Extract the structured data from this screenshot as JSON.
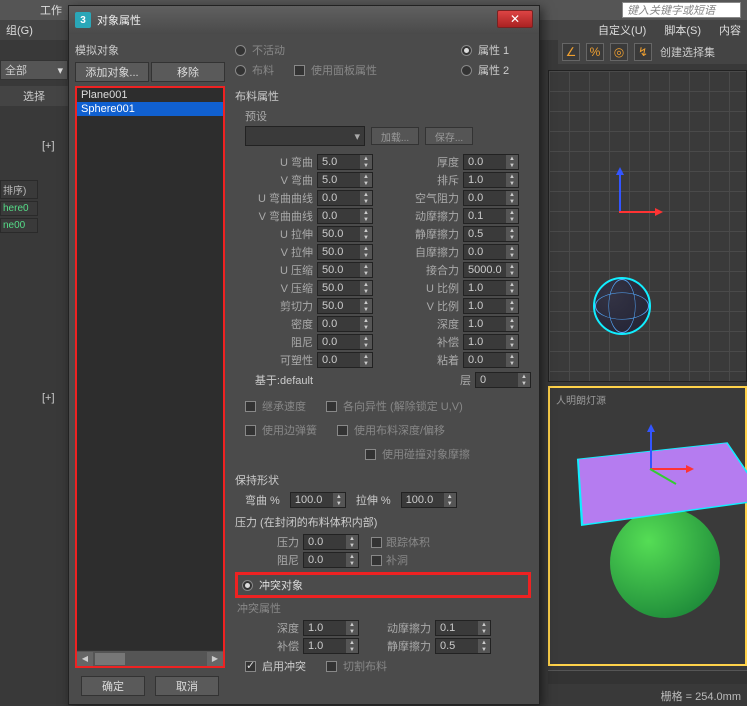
{
  "bg": {
    "topTabs": [
      "工作"
    ],
    "search_placeholder": "键入关键字或短语",
    "menubar": [
      "组(G)"
    ],
    "menubarRight": [
      "自定义(U)",
      "脚本(S)",
      "内容"
    ],
    "iconRowLabel": "创建选择集",
    "dropdown": "全部",
    "select": "选择",
    "leftTabs": [
      "排序)",
      "here0",
      "ne00"
    ],
    "marker1": "[+]",
    "marker2": "[+]",
    "vpLabel": "人明朗灯源",
    "status": "栅格 = 254.0mm"
  },
  "dialog": {
    "title": "对象属性",
    "icon": "3",
    "left": {
      "section": "模拟对象",
      "addBtn": "添加对象...",
      "removeBtn": "移除",
      "items": [
        "Plane001",
        "Sphere001"
      ],
      "ok": "确定",
      "cancel": "取消"
    },
    "right": {
      "radios": {
        "inactive": "不活动",
        "cloth": "布料",
        "useFaceCloth": "使用面板属性",
        "prop1": "属性 1",
        "prop2": "属性 2"
      },
      "clothProps": "布料属性",
      "preset": "预设",
      "loadBtn": "加载...",
      "saveBtn": "保存...",
      "paramsLeft": [
        {
          "l": "U 弯曲",
          "v": "5.0"
        },
        {
          "l": "V 弯曲",
          "v": "5.0"
        },
        {
          "l": "U 弯曲曲线",
          "v": "0.0"
        },
        {
          "l": "V 弯曲曲线",
          "v": "0.0"
        },
        {
          "l": "U 拉伸",
          "v": "50.0"
        },
        {
          "l": "V 拉伸",
          "v": "50.0"
        },
        {
          "l": "U 压缩",
          "v": "50.0"
        },
        {
          "l": "V 压缩",
          "v": "50.0"
        },
        {
          "l": "剪切力",
          "v": "50.0"
        },
        {
          "l": "密度",
          "v": "0.0"
        },
        {
          "l": "阻尼",
          "v": "0.0"
        },
        {
          "l": "可塑性",
          "v": "0.0"
        }
      ],
      "paramsRight": [
        {
          "l": "厚度",
          "v": "0.0"
        },
        {
          "l": "排斥",
          "v": "1.0"
        },
        {
          "l": "空气阻力",
          "v": "0.0"
        },
        {
          "l": "动摩擦力",
          "v": "0.1"
        },
        {
          "l": "静摩擦力",
          "v": "0.5"
        },
        {
          "l": "自摩擦力",
          "v": "0.0"
        },
        {
          "l": "接合力",
          "v": "5000.0"
        },
        {
          "l": "U 比例",
          "v": "1.0"
        },
        {
          "l": "V 比例",
          "v": "1.0"
        },
        {
          "l": "深度",
          "v": "1.0"
        },
        {
          "l": "补偿",
          "v": "1.0"
        },
        {
          "l": "粘着",
          "v": "0.0"
        }
      ],
      "basedOn": "基于:",
      "basedOnVal": "default",
      "layerLbl": "层",
      "layerVal": "0",
      "checks": [
        "继承速度",
        "各向异性 (解除锁定 U,V)",
        "使用边弹簧",
        "使用布料深度/偏移",
        "使用碰撞对象摩擦"
      ],
      "keepShape": "保持形状",
      "bendPct": "弯曲 %",
      "bendVal": "100.0",
      "stretchPct": "拉伸 %",
      "stretchVal": "100.0",
      "pressureTitle": "压力 (在封闭的布料体积内部)",
      "pressureLbl": "压力",
      "pressureVal": "0.0",
      "trackVol": "跟踪体积",
      "dampLbl": "阻尼",
      "dampVal": "0.0",
      "patch": "补洞",
      "collisionObj": "冲突对象",
      "collisionProps": "冲突属性",
      "depthLbl": "深度",
      "depthVal": "1.0",
      "offsetLbl": "补偿",
      "offsetVal": "1.0",
      "dynFricLbl": "动摩擦力",
      "dynFricVal": "0.1",
      "statFricLbl": "静摩擦力",
      "statFricVal": "0.5",
      "enableColl": "启用冲突",
      "cutCloth": "切割布料"
    }
  }
}
